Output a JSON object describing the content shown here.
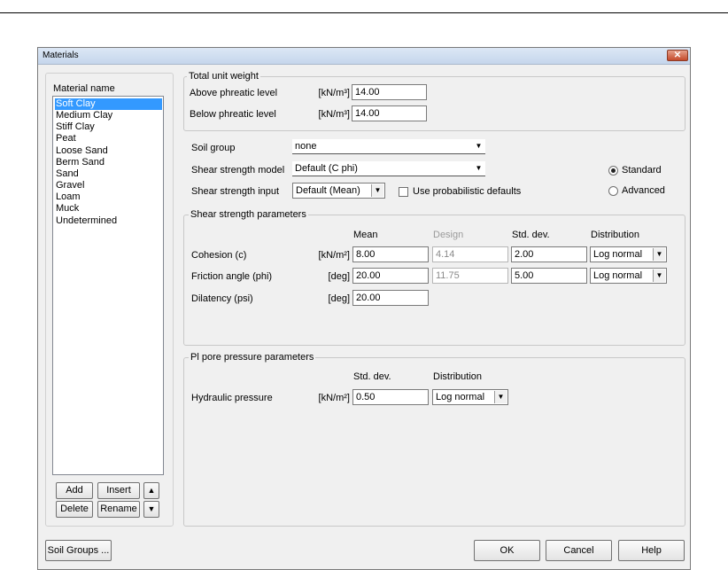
{
  "window": {
    "title": "Materials",
    "close_glyph": "✕"
  },
  "materials": {
    "header": "Material name",
    "items": [
      "Soft Clay",
      "Medium Clay",
      "Stiff Clay",
      "Peat",
      "Loose Sand",
      "Berm Sand",
      "Sand",
      "Gravel",
      "Loam",
      "Muck",
      "Undetermined"
    ],
    "selected": "Soft Clay",
    "buttons": {
      "add": "Add",
      "insert": "Insert",
      "delete": "Delete",
      "rename": "Rename",
      "up": "▲",
      "down": "▼"
    }
  },
  "unit_weight": {
    "title": "Total unit weight",
    "above_label": "Above phreatic level",
    "above_unit": "[kN/m³]",
    "above_value": "14.00",
    "below_label": "Below phreatic level",
    "below_unit": "[kN/m³]",
    "below_value": "14.00"
  },
  "soil": {
    "group_label": "Soil group",
    "group_value": "none",
    "model_label": "Shear strength model",
    "model_value": "Default (C phi)",
    "input_label": "Shear strength input",
    "input_value": "Default (Mean)",
    "probabilistic_label": "Use probabilistic defaults",
    "standard_label": "Standard",
    "advanced_label": "Advanced"
  },
  "shear": {
    "title": "Shear strength parameters",
    "col_mean": "Mean",
    "col_design": "Design",
    "col_std": "Std. dev.",
    "col_dist": "Distribution",
    "rows": [
      {
        "label": "Cohesion (c)",
        "unit": "[kN/m²]",
        "mean": "8.00",
        "design": "4.14",
        "std": "2.00",
        "dist": "Log normal"
      },
      {
        "label": "Friction angle (phi)",
        "unit": "[deg]",
        "mean": "20.00",
        "design": "11.75",
        "std": "5.00",
        "dist": "Log normal"
      },
      {
        "label": "Dilatency (psi)",
        "unit": "[deg]",
        "mean": "20.00"
      }
    ]
  },
  "pl_pore": {
    "title": "Pl pore pressure parameters",
    "col_std": "Std. dev.",
    "col_dist": "Distribution",
    "label": "Hydraulic pressure",
    "unit": "[kN/m²]",
    "std": "0.50",
    "dist": "Log normal"
  },
  "footer": {
    "soil_groups": "Soil Groups ...",
    "ok": "OK",
    "cancel": "Cancel",
    "help": "Help"
  },
  "icons": {
    "combo_arrow": "▼"
  }
}
